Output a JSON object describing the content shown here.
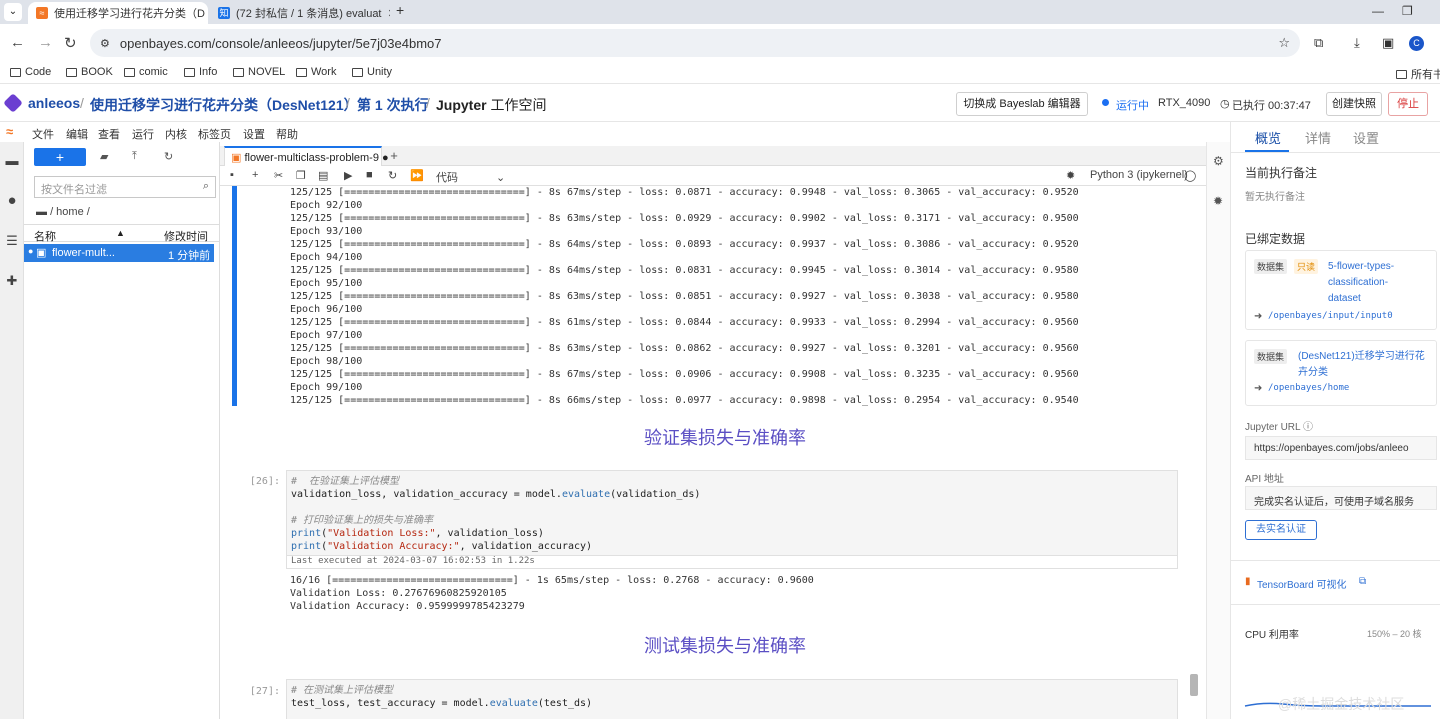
{
  "browser": {
    "tabs": [
      {
        "title": "使用迁移学习进行花卉分类（D",
        "active": true
      },
      {
        "title": "(72 封私信 / 1 条消息) evaluat",
        "active": false
      }
    ],
    "new_tab": "+",
    "url": "openbayes.com/console/anleeos/jupyter/5e7j03e4bmo7",
    "avatar_letter": "C",
    "bookmarks": [
      "Code",
      "BOOK",
      "comic",
      "Info",
      "NOVEL",
      "Work",
      "Unity"
    ],
    "other_bookmarks": "所有书"
  },
  "header": {
    "user": "anleeos",
    "project": "使用迁移学习进行花卉分类（DesNet121）",
    "run": "第 1 次执行",
    "workspace_bold": "Jupyter",
    "workspace_rest": "工作空间",
    "switch_btn": "切换成 Bayeslab 编辑器",
    "status": "运行中",
    "gpu": "RTX_4090",
    "elapsed": "已执行 00:37:47",
    "snapshot_btn": "创建快照",
    "stop_btn": "停止"
  },
  "jupyter_menu": [
    "文件",
    "编辑",
    "查看",
    "运行",
    "内核",
    "标签页",
    "设置",
    "帮助"
  ],
  "file_browser": {
    "new_label": "+",
    "filter_placeholder": "按文件名过滤",
    "path": "/ home /",
    "col_name": "名称",
    "col_modified": "修改时间",
    "files": [
      {
        "name": "flower-mult...",
        "modified": "1 分钟前"
      }
    ]
  },
  "notebook": {
    "tab_title": "flower-multiclass-problem-9",
    "cell_type": "代码",
    "kernel": "Python 3 (ipykernel)",
    "training_lines": [
      "125/125 [==============================] - 8s 67ms/step - loss: 0.0871 - accuracy: 0.9948 - val_loss: 0.3065 - val_accuracy: 0.9520",
      "Epoch 92/100",
      "125/125 [==============================] - 8s 63ms/step - loss: 0.0929 - accuracy: 0.9902 - val_loss: 0.3171 - val_accuracy: 0.9500",
      "Epoch 93/100",
      "125/125 [==============================] - 8s 64ms/step - loss: 0.0893 - accuracy: 0.9937 - val_loss: 0.3086 - val_accuracy: 0.9520",
      "Epoch 94/100",
      "125/125 [==============================] - 8s 64ms/step - loss: 0.0831 - accuracy: 0.9945 - val_loss: 0.3014 - val_accuracy: 0.9580",
      "Epoch 95/100",
      "125/125 [==============================] - 8s 63ms/step - loss: 0.0851 - accuracy: 0.9927 - val_loss: 0.3038 - val_accuracy: 0.9580",
      "Epoch 96/100",
      "125/125 [==============================] - 8s 61ms/step - loss: 0.0844 - accuracy: 0.9933 - val_loss: 0.2994 - val_accuracy: 0.9560",
      "Epoch 97/100",
      "125/125 [==============================] - 8s 63ms/step - loss: 0.0862 - accuracy: 0.9927 - val_loss: 0.3201 - val_accuracy: 0.9560",
      "Epoch 98/100",
      "125/125 [==============================] - 8s 67ms/step - loss: 0.0906 - accuracy: 0.9908 - val_loss: 0.3235 - val_accuracy: 0.9560",
      "Epoch 99/100",
      "125/125 [==============================] - 8s 66ms/step - loss: 0.0977 - accuracy: 0.9898 - val_loss: 0.2954 - val_accuracy: 0.9540"
    ],
    "heading1": "验证集损失与准确率",
    "cell26": {
      "prompt": "[26]:",
      "code": [
        {
          "cls": "cm",
          "text": "#  在验证集上评估模型"
        },
        {
          "cls": "",
          "text": "validation_loss, validation_accuracy = model.evaluate(validation_ds)"
        },
        {
          "cls": "",
          "text": " "
        },
        {
          "cls": "cm",
          "text": "# 打印验证集上的损失与准确率"
        },
        {
          "cls": "mix1",
          "text": "print(\"Validation Loss:\", validation_loss)"
        },
        {
          "cls": "mix2",
          "text": "print(\"Validation Accuracy:\", validation_accuracy)"
        }
      ],
      "last_executed": "Last executed at 2024-03-07 16:02:53 in 1.22s",
      "output": [
        "16/16 [==============================] - 1s 65ms/step - loss: 0.2768 - accuracy: 0.9600",
        "Validation Loss: 0.27676960825920105",
        "Validation Accuracy: 0.9599999785423279"
      ]
    },
    "heading2": "测试集损失与准确率",
    "cell27": {
      "prompt": "[27]:",
      "code": [
        {
          "cls": "cm",
          "text": "# 在测试集上评估模型"
        },
        {
          "cls": "",
          "text": "test_loss, test_accuracy = model.evaluate(test_ds)"
        }
      ]
    }
  },
  "right_panel": {
    "tabs": [
      "概览",
      "详情",
      "设置"
    ],
    "notes_title": "当前执行备注",
    "notes_empty": "暂无执行备注",
    "bound_title": "已绑定数据",
    "dataset1": {
      "tag": "数据集",
      "ro": "只读",
      "name": "5-flower-types-classification-dataset",
      "path": "/openbayes/input/input0"
    },
    "dataset2": {
      "tag": "数据集",
      "name": "(DesNet121)迁移学习进行花卉分类",
      "path": "/openbayes/home"
    },
    "jupyter_url_label": "Jupyter URL",
    "jupyter_url": "https://openbayes.com/jobs/anleeo",
    "api_label": "API 地址",
    "api_text": "完成实名认证后，可使用子域名服务",
    "verify_btn": "去实名认证",
    "tensorboard": "TensorBoard 可视化",
    "cpu_label": "CPU 利用率",
    "cpu_value": "150% – 20 核"
  },
  "watermark": "@稀土掘金技术社区",
  "colors": {
    "accent": "#1a73e8",
    "heading": "#5b4fc4",
    "brand": "#6b3fd1",
    "stop": "#d93b3b"
  }
}
